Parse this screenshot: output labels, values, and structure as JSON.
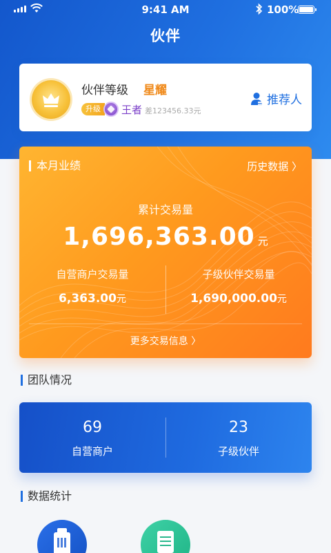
{
  "status_bar": {
    "time": "9:41 AM",
    "battery": "100%"
  },
  "nav": {
    "title": "伙伴"
  },
  "level_card": {
    "level_label": "伙伴等级",
    "level_value": "星耀",
    "upgrade_label": "升级",
    "next_level": "王者",
    "diff_text": "差123456.33元",
    "recommender_label": "推荐人"
  },
  "performance": {
    "title": "本月业绩",
    "history_link": "历史数据 〉",
    "total_label": "累计交易量",
    "total_value": "1,696,363.00",
    "unit": "元",
    "self_label": "自营商户交易量",
    "self_value": "6,363.00",
    "child_label": "子级伙伴交易量",
    "child_value": "1,690,000.00",
    "more_link": "更多交易信息 〉"
  },
  "team": {
    "section_title": "团队情况",
    "self_count": "69",
    "self_label": "自营商户",
    "child_count": "23",
    "child_label": "子级伙伴"
  },
  "stats": {
    "section_title": "数据统计",
    "icons": [
      "pos-terminal-icon",
      "document-icon"
    ]
  },
  "colors": {
    "primary_blue": "#1f6fe0",
    "accent_orange": "#ff9a1e",
    "level_gold": "#f08a1b",
    "king_purple": "#7b3fc8",
    "teal": "#2ac39a"
  }
}
